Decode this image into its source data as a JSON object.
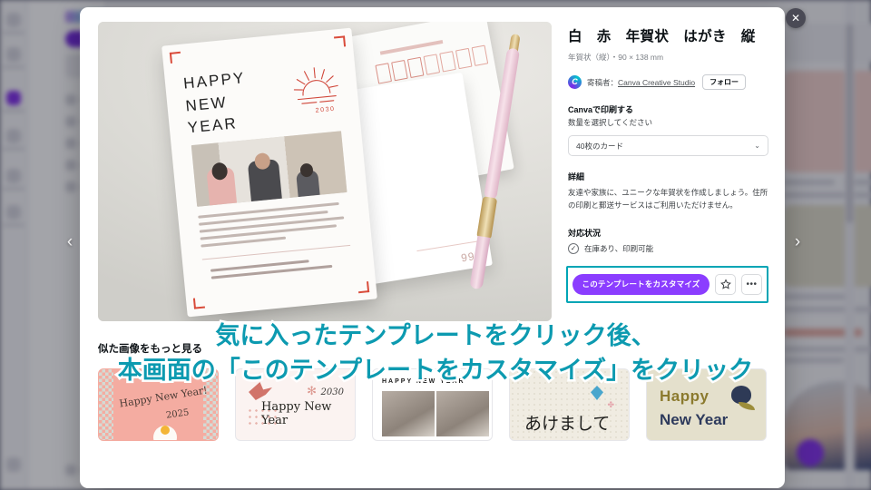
{
  "window": {
    "close_label": "✕"
  },
  "nav": {
    "prev_icon": "chevron-left-icon",
    "next_icon": "chevron-right-icon",
    "prev_label": "‹",
    "next_label": "›"
  },
  "detail": {
    "title": "白　赤　年賀状　はがき　縦",
    "dimensions": "年賀状（縦）・90 × 138 mm",
    "author_prefix": "寄稿者：",
    "author_name": "Canva Creative Studio",
    "avatar_letter": "C",
    "follow_label": "フォロー",
    "print_heading": "Canvaで印刷する",
    "print_sub": "数量を選択してください",
    "quantity_value": "40枚のカード",
    "quantity_chevron": "⌄",
    "details_heading": "詳細",
    "details_text": "友達や家族に、ユニークな年賀状を作成しましょう。住所の印刷と郵送サービスはご利用いただけません。",
    "availability_heading": "対応状況",
    "availability_text": "在庫あり、印刷可能",
    "availability_icon": "check-circle-icon",
    "cta_label": "このテンプレートをカスタマイズ",
    "favorite_icon": "star-icon",
    "more_icon": "more-options-icon",
    "more_label": "•••",
    "highlight_color": "#00a5b5",
    "cta_color": "#8b3dff"
  },
  "preview": {
    "card_greeting_line1": "HAPPY",
    "card_greeting_line2": "NEW",
    "card_greeting_line3": "YEAR",
    "card_year": "2030",
    "sunrise_icon": "sunrise-icon",
    "mid_card_number": "999"
  },
  "similar": {
    "heading": "似た画像をもっと見る",
    "thumbs": [
      {
        "name": "thumb-pink-happy-new-year-2025",
        "line1": "Happy New Year!",
        "line2": "2025"
      },
      {
        "name": "thumb-crane-happy-new-year",
        "line1": "Happy New Year",
        "line2": "2030"
      },
      {
        "name": "thumb-photo-collage",
        "line1": "HAPPY NEW YEAR",
        "line2": ""
      },
      {
        "name": "thumb-brush-calligraphy",
        "line1": "あけまして",
        "line2": ""
      },
      {
        "name": "thumb-olive-happy-new-year",
        "line1": "Happy",
        "line2": "New Year"
      }
    ]
  },
  "overlay": {
    "line1": "気に入ったテンプレートをクリック後、",
    "line2": "本画面の「このテンプレートをカスタマイズ」をクリック",
    "color": "#0c9ab0"
  }
}
